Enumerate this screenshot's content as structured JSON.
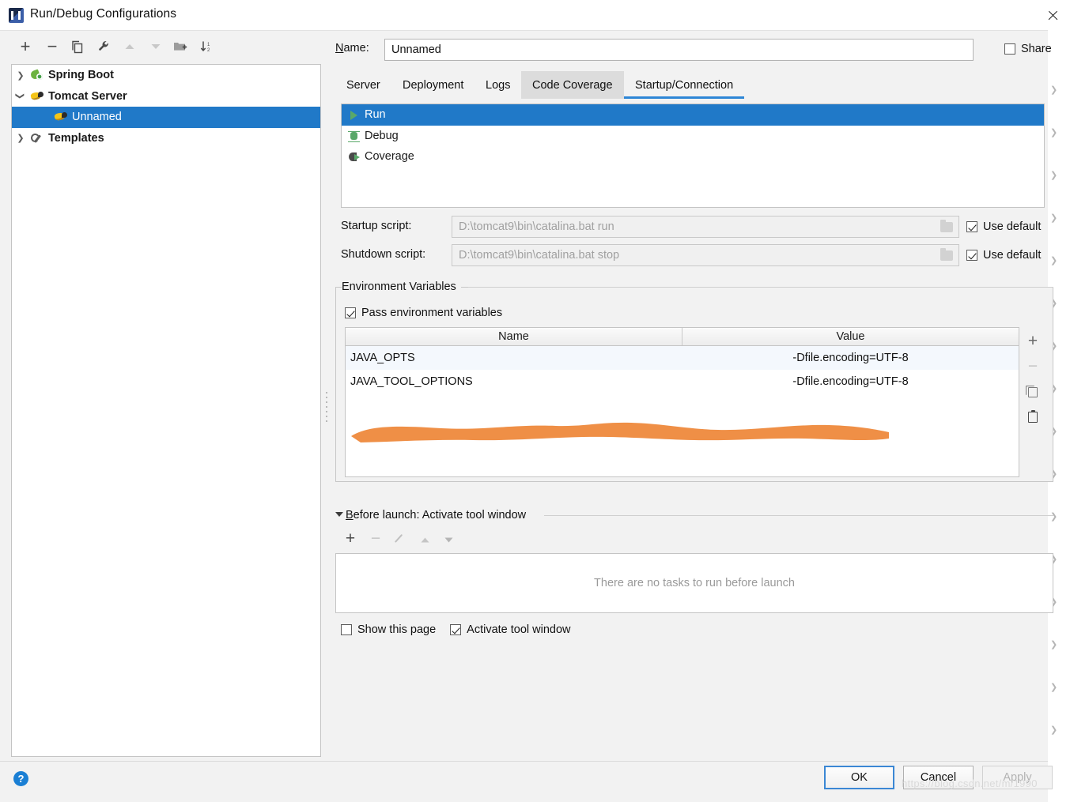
{
  "window": {
    "title": "Run/Debug Configurations",
    "app_icon": "intellij-idea-icon",
    "close_icon": "close-icon"
  },
  "left_toolbar": {
    "buttons": [
      {
        "name": "add-configuration-button",
        "icon": "plus-icon",
        "glyph": "+",
        "enabled": true
      },
      {
        "name": "remove-configuration-button",
        "icon": "minus-icon",
        "glyph": "−",
        "enabled": true
      },
      {
        "name": "copy-configuration-button",
        "icon": "copy-icon",
        "glyph": "❐",
        "enabled": true
      },
      {
        "name": "edit-templates-button",
        "icon": "wrench-icon",
        "glyph": "ὒ7",
        "enabled": true
      },
      {
        "name": "move-up-button",
        "icon": "arrow-up-icon",
        "glyph": "▲",
        "enabled": false
      },
      {
        "name": "move-down-button",
        "icon": "arrow-down-icon",
        "glyph": "▼",
        "enabled": false
      },
      {
        "name": "new-folder-button",
        "icon": "folder-add-icon",
        "glyph": "▤",
        "enabled": true
      },
      {
        "name": "sort-configurations-button",
        "icon": "sort-icon",
        "glyph": "↧",
        "enabled": true
      }
    ]
  },
  "tree": {
    "nodes": [
      {
        "label": "Spring Boot",
        "icon": "spring-boot-icon",
        "expanded": false,
        "selected": false,
        "indent": 0
      },
      {
        "label": "Tomcat Server",
        "icon": "tomcat-icon",
        "expanded": true,
        "selected": false,
        "indent": 0
      },
      {
        "label": "Unnamed",
        "icon": "tomcat-icon",
        "expanded": null,
        "selected": true,
        "indent": 1
      },
      {
        "label": "Templates",
        "icon": "wrench-icon",
        "expanded": false,
        "selected": false,
        "indent": 0
      }
    ]
  },
  "name_row": {
    "label": "Name:",
    "label_mnemonic": "N",
    "value": "Unnamed",
    "placeholder": "",
    "share_label": "Share",
    "share_checked": false
  },
  "tabs": {
    "items": [
      {
        "label": "Server",
        "active": false,
        "hover": false
      },
      {
        "label": "Deployment",
        "active": false,
        "hover": false
      },
      {
        "label": "Logs",
        "active": false,
        "hover": false
      },
      {
        "label": "Code Coverage",
        "active": false,
        "hover": true
      },
      {
        "label": "Startup/Connection",
        "active": true,
        "hover": false
      }
    ],
    "active_underline_color": "#2e87d6",
    "hover_background_color": "#dcdcdc"
  },
  "mode_list": {
    "items": [
      {
        "label": "Run",
        "icon": "run-icon",
        "selected": true
      },
      {
        "label": "Debug",
        "icon": "debug-icon",
        "selected": false
      },
      {
        "label": "Coverage",
        "icon": "coverage-icon",
        "selected": false
      }
    ],
    "selection_color": "#2079c8"
  },
  "scripts": {
    "startup": {
      "label": "Startup script:",
      "value": "D:\\tomcat9\\bin\\catalina.bat run",
      "browse_icon": "folder-icon",
      "use_default_label": "Use default",
      "use_default_checked": true,
      "enabled": false
    },
    "shutdown": {
      "label": "Shutdown script:",
      "value": "D:\\tomcat9\\bin\\catalina.bat stop",
      "browse_icon": "folder-icon",
      "use_default_label": "Use default",
      "use_default_checked": true,
      "enabled": false
    }
  },
  "environment": {
    "group_title": "Environment Variables",
    "pass_env_label": "Pass environment variables",
    "pass_env_checked": true,
    "columns": [
      "Name",
      "Value"
    ],
    "rows": [
      {
        "name": "JAVA_OPTS",
        "value": "-Dfile.encoding=UTF-8"
      },
      {
        "name": "JAVA_TOOL_OPTIONS",
        "value": "-Dfile.encoding=UTF-8"
      }
    ],
    "tools": [
      {
        "name": "add-variable-button",
        "icon": "plus-icon",
        "glyph": "+",
        "enabled": true
      },
      {
        "name": "remove-variable-button",
        "icon": "minus-icon",
        "glyph": "−",
        "enabled": false
      },
      {
        "name": "copy-variable-button",
        "icon": "copy-icon",
        "glyph": "",
        "enabled": false
      },
      {
        "name": "paste-variable-button",
        "icon": "paste-icon",
        "glyph": "",
        "enabled": true
      }
    ]
  },
  "annotation": {
    "type": "orange-highlight-stroke",
    "color": "#ef8f46"
  },
  "before_launch": {
    "title": "Before launch: Activate tool window",
    "title_mnemonic": "B",
    "expanded": true,
    "toolbar": [
      {
        "name": "add-task-button",
        "icon": "plus-icon",
        "glyph": "+",
        "enabled": true
      },
      {
        "name": "remove-task-button",
        "icon": "minus-icon",
        "glyph": "−",
        "enabled": false
      },
      {
        "name": "edit-task-button",
        "icon": "pencil-icon",
        "glyph": "",
        "enabled": false
      },
      {
        "name": "move-task-up-button",
        "icon": "arrow-up-icon",
        "glyph": "▲",
        "enabled": false
      },
      {
        "name": "move-task-down-button",
        "icon": "arrow-down-icon",
        "glyph": "▼",
        "enabled": false
      }
    ],
    "empty_text": "There are no tasks to run before launch"
  },
  "bottom_options": [
    {
      "label": "Show this page",
      "checked": false,
      "name": "show-this-page-checkbox"
    },
    {
      "label": "Activate tool window",
      "checked": true,
      "name": "activate-tool-window-checkbox"
    }
  ],
  "footer": {
    "help_icon": "help-icon",
    "help_glyph": "?",
    "buttons": [
      {
        "label": "OK",
        "name": "ok-button",
        "focused": true,
        "enabled": true
      },
      {
        "label": "Cancel",
        "name": "cancel-button",
        "focused": false,
        "enabled": true
      },
      {
        "label": "Apply",
        "name": "apply-button",
        "focused": false,
        "enabled": false
      }
    ],
    "watermark": "https://blog.csdn.net/m/1990"
  },
  "colors": {
    "selection_blue": "#2079c8",
    "tab_accent": "#2e87d6",
    "annotation_orange": "#ef8f46",
    "dialog_background": "#f2f2f2",
    "panel_background": "#ffffff",
    "alt_row": "#f4f8fd"
  }
}
